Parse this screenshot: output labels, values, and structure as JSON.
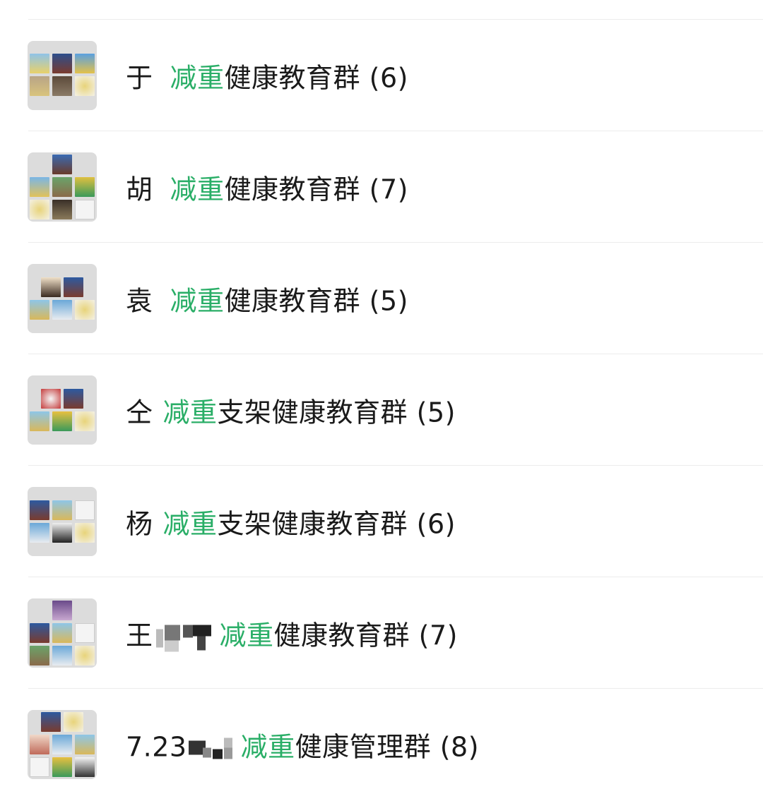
{
  "groups": [
    {
      "owner": "于",
      "keyword": "减重",
      "suffix": "健康教育群",
      "count": "(6)",
      "masked": false
    },
    {
      "owner": "胡",
      "keyword": "减重",
      "suffix": "健康教育群",
      "count": "(7)",
      "masked": false
    },
    {
      "owner": "袁",
      "keyword": "减重",
      "suffix": "健康教育群",
      "count": "(5)",
      "masked": false
    },
    {
      "owner": "仝",
      "keyword": "减重",
      "suffix": "支架健康教育群",
      "count": "(5)",
      "masked": false
    },
    {
      "owner": "杨",
      "keyword": "减重",
      "suffix": "支架健康教育群",
      "count": "(6)",
      "masked": false
    },
    {
      "owner": "王",
      "keyword": "减重",
      "suffix": "健康教育群",
      "count": "(7)",
      "masked": true
    },
    {
      "owner": "7.23",
      "keyword": "减重",
      "suffix": "健康管理群",
      "count": "(8)",
      "masked": true
    }
  ],
  "colors": {
    "keyword": "#2aae67",
    "text": "#1a1a1a",
    "divider": "#ececec",
    "avatar_bg": "#dcdcdc"
  }
}
